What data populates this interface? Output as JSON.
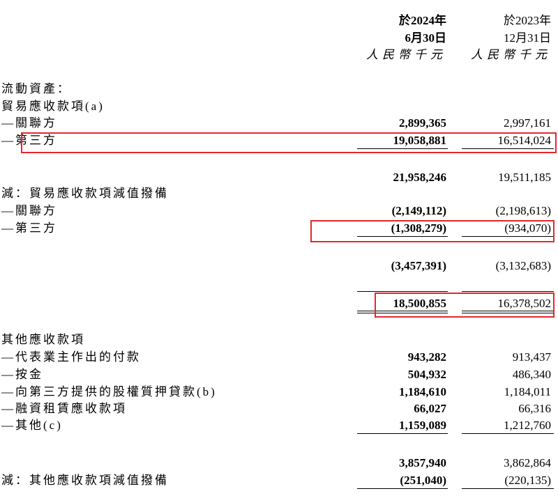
{
  "header": {
    "col1": {
      "line1": "於2024年",
      "line2": "6月30日",
      "line3": "人民幣千元"
    },
    "col2": {
      "line1": "於2023年",
      "line2": "12月31日",
      "line3": "人民幣千元"
    }
  },
  "rows": [
    {
      "label": "流動資產："
    },
    {
      "label": "貿易應收款項(a)"
    },
    {
      "label": "—關聯方",
      "v2024": "2,899,365",
      "v2023": "2,997,161"
    },
    {
      "label": "—第三方",
      "v2024": "19,058,881",
      "v2023": "16,514,024"
    },
    {
      "label": "",
      "v2024": "21,958,246",
      "v2023": "19,511,185"
    },
    {
      "label": "減：貿易應收款項減值撥備"
    },
    {
      "label": "—關聯方",
      "v2024": "(2,149,112)",
      "v2023": "(2,198,613)"
    },
    {
      "label": "—第三方",
      "v2024": "(1,308,279)",
      "v2023": "(934,070)"
    },
    {
      "label": "",
      "v2024": "(3,457,391)",
      "v2023": "(3,132,683)"
    },
    {
      "label": "",
      "v2024": "18,500,855",
      "v2023": "16,378,502"
    },
    {
      "label": "其他應收款項"
    },
    {
      "label": "—代表業主作出的付款",
      "v2024": "943,282",
      "v2023": "913,437"
    },
    {
      "label": "—按金",
      "v2024": "504,932",
      "v2023": "486,340"
    },
    {
      "label": "—向第三方提供的股權質押貸款(b)",
      "v2024": "1,184,610",
      "v2023": "1,184,011"
    },
    {
      "label": "—融資租賃應收款項",
      "v2024": "66,027",
      "v2023": "66,316"
    },
    {
      "label": "—其他(c)",
      "v2024": "1,159,089",
      "v2023": "1,212,760"
    },
    {
      "label": "",
      "v2024": "3,857,940",
      "v2023": "3,862,864"
    },
    {
      "label": "減：其他應收款項減值撥備",
      "v2024": "(251,040)",
      "v2023": "(220,135)"
    }
  ],
  "highlight_color": "#e8262a"
}
